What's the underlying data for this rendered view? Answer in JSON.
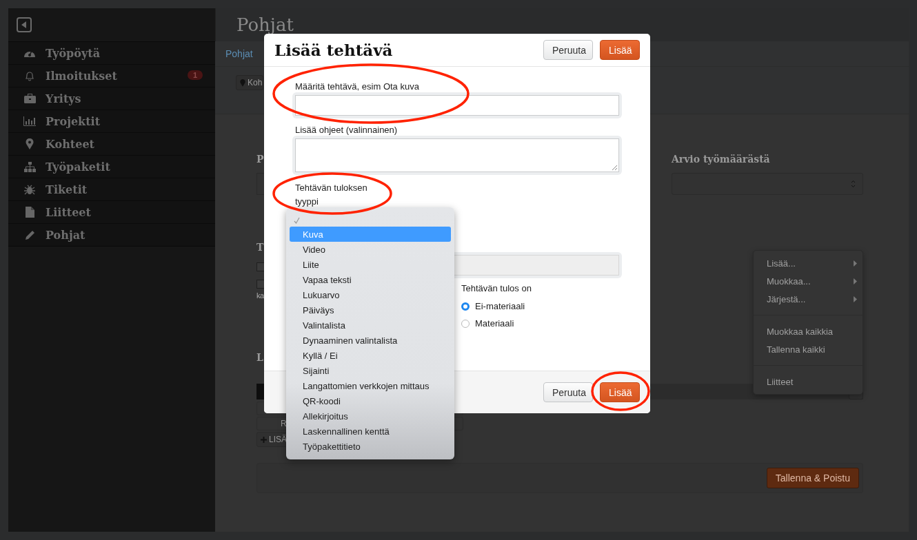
{
  "sidebar": {
    "items": [
      {
        "kind": "dashboard",
        "label": "Työpöytä"
      },
      {
        "kind": "bell",
        "label": "Ilmoitukset",
        "badge": "1"
      },
      {
        "kind": "briefcase",
        "label": "Yritys"
      },
      {
        "kind": "chart",
        "label": "Projektit"
      },
      {
        "kind": "pin",
        "label": "Kohteet"
      },
      {
        "kind": "sitemap",
        "label": "Työpaketit"
      },
      {
        "kind": "bug",
        "label": "Tiketit"
      },
      {
        "kind": "file",
        "label": "Liitteet"
      },
      {
        "kind": "pencil",
        "label": "Pohjat"
      }
    ]
  },
  "page": {
    "title": "Pohjat",
    "breadcrumb": "Pohjat",
    "location_button": "Koh",
    "label_1": "P",
    "heading_2": "T",
    "text_3": "ka",
    "heading_4": "L",
    "row_text": "R",
    "add_button": "LISÄ",
    "estimate_label": "Arvio työmäärästä",
    "save_button": "Tallenna & Poistu"
  },
  "checkboxes": [
    {
      "checked": false
    },
    {
      "checked": false
    }
  ],
  "context_menu": {
    "groups": [
      [
        {
          "label": "Lisää...",
          "submenu": true
        },
        {
          "label": "Muokkaa...",
          "submenu": true
        },
        {
          "label": "Järjestä...",
          "submenu": true
        }
      ],
      [
        {
          "label": "Muokkaa kaikkia",
          "submenu": false
        },
        {
          "label": "Tallenna kaikki",
          "submenu": false
        }
      ],
      [
        {
          "label": "Liitteet",
          "submenu": false
        }
      ]
    ]
  },
  "modal": {
    "title": "Lisää tehtävä",
    "header_buttons": [
      {
        "label": "Peruuta",
        "kind": "default"
      },
      {
        "label": "Lisää",
        "kind": "primary"
      }
    ],
    "task_label": "Määritä tehtävä, esim Ota kuva",
    "instructions_label": "Lisää ohjeet (valinnainen)",
    "result_type_label": "Tehtävän tuloksen tyyppi",
    "result_is_label": "Tehtävän tulos on",
    "radios": [
      {
        "label": "Ei-materiaali",
        "selected": true
      },
      {
        "label": "Materiaali",
        "selected": false
      }
    ],
    "footer_buttons": [
      {
        "label": "Peruuta",
        "kind": "default"
      },
      {
        "label": "Lisää",
        "kind": "primary"
      }
    ]
  },
  "dropdown": {
    "options": [
      {
        "checked": true,
        "selected": false
      },
      {
        "label": "Kuva",
        "checked": false,
        "selected": true
      },
      {
        "label": "Video",
        "checked": false,
        "selected": false
      },
      {
        "label": "Liite",
        "checked": false,
        "selected": false
      },
      {
        "label": "Vapaa teksti",
        "checked": false,
        "selected": false
      },
      {
        "label": "Lukuarvo",
        "checked": false,
        "selected": false
      },
      {
        "label": "Päiväys",
        "checked": false,
        "selected": false
      },
      {
        "label": "Valintalista",
        "checked": false,
        "selected": false
      },
      {
        "label": "Dynaaminen valintalista",
        "checked": false,
        "selected": false
      },
      {
        "label": "Kyllä / Ei",
        "checked": false,
        "selected": false
      },
      {
        "label": "Sijainti",
        "checked": false,
        "selected": false
      },
      {
        "label": "Langattomien verkkojen mittaus",
        "checked": false,
        "selected": false
      },
      {
        "label": "QR-koodi",
        "checked": false,
        "selected": false
      },
      {
        "label": "Allekirjoitus",
        "checked": false,
        "selected": false
      },
      {
        "label": "Laskennallinen kenttä",
        "checked": false,
        "selected": false
      },
      {
        "label": "Työpakettitieto",
        "checked": false,
        "selected": false
      }
    ]
  }
}
